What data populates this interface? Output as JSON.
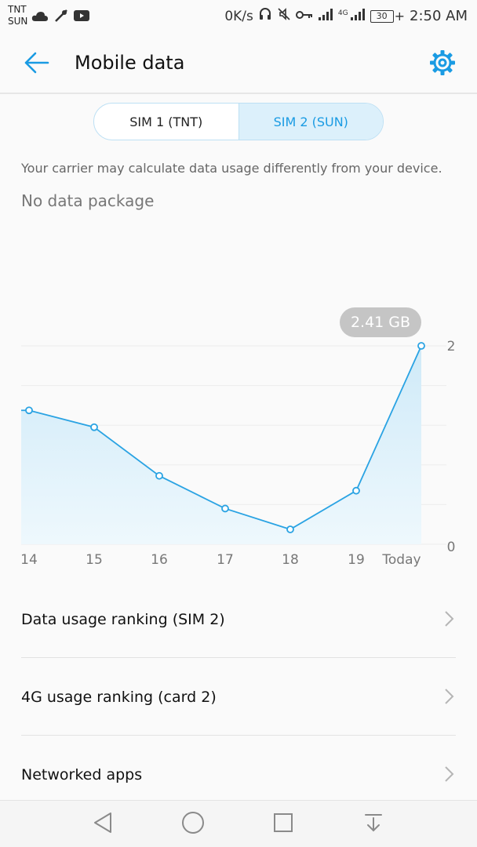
{
  "status_bar": {
    "carrier_1": "TNT",
    "carrier_2": "SUN",
    "speed": "0K/s",
    "network_type": "4G",
    "battery": "30",
    "time": "2:50 AM"
  },
  "header": {
    "title": "Mobile data"
  },
  "sim_tabs": [
    {
      "label": "SIM 1 (TNT)",
      "active": false
    },
    {
      "label": "SIM 2 (SUN)",
      "active": true
    }
  ],
  "notice": "Your carrier may calculate data usage differently from your device.",
  "package": "No data package",
  "chart_data": {
    "type": "area",
    "categories": [
      "14",
      "15",
      "16",
      "17",
      "18",
      "19",
      "Today"
    ],
    "values": [
      1.35,
      1.18,
      0.69,
      0.36,
      0.15,
      0.54,
      2.0
    ],
    "y_tick_labels": [
      "2",
      "0"
    ],
    "ylim": [
      0,
      2
    ],
    "highlight_label": "2.41 GB",
    "grid": true,
    "colors": {
      "line": "#2aa3e3",
      "fill_top": "#cfeaf8",
      "fill_bottom": "#eef8fd"
    }
  },
  "list": [
    {
      "label": "Data usage ranking (SIM 2)"
    },
    {
      "label": "4G usage ranking (card 2)"
    },
    {
      "label": "Networked apps"
    }
  ],
  "colors": {
    "accent": "#1a9be3",
    "active_tab_bg": "#dcf0fb"
  }
}
